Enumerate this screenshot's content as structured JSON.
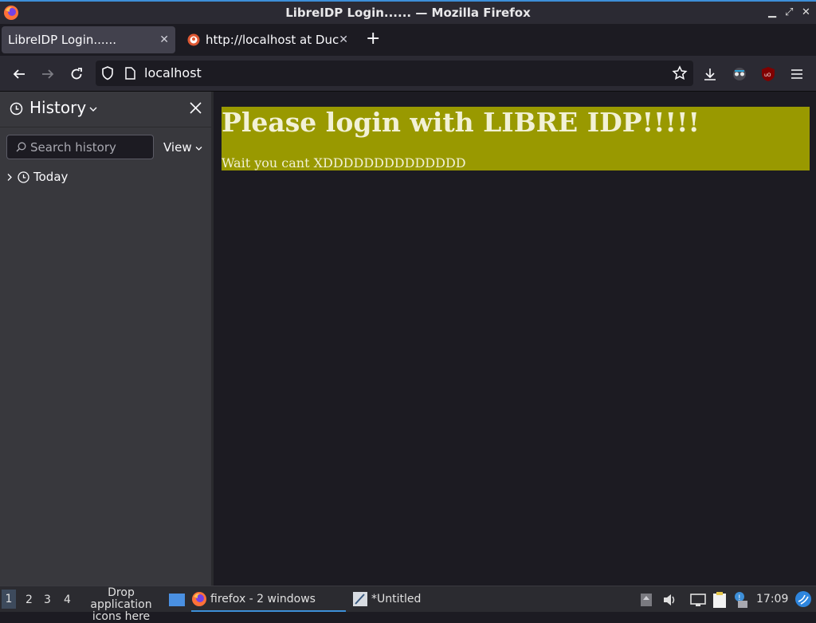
{
  "window": {
    "title": "LibreIDP Login...... — Mozilla Firefox"
  },
  "tabs": [
    {
      "label": "LibreIDP Login......",
      "active": true
    },
    {
      "label": "http://localhost at Duc",
      "active": false
    }
  ],
  "urlbar": {
    "url": "localhost"
  },
  "sidebar": {
    "title": "History",
    "search_placeholder": "Search history",
    "view_label": "View",
    "groups": [
      {
        "label": "Today"
      }
    ]
  },
  "page": {
    "heading": "Please login with LIBRE IDP!!!!!",
    "text": "Wait you cant XDDDDDDDDDDDDDD",
    "banner_color": "#999900"
  },
  "taskbar": {
    "workspaces": [
      "1",
      "2",
      "3",
      "4"
    ],
    "drop_label": "Drop application icons here",
    "tasks": [
      {
        "label": "firefox - 2 windows",
        "icon": "firefox-icon"
      },
      {
        "label": "*Untitled",
        "icon": "text-editor-icon"
      }
    ],
    "clock": "17:09"
  },
  "colors": {
    "accent": "#3d8fd8",
    "toolbar": "#2b2a33",
    "sidebar": "#38383d"
  }
}
